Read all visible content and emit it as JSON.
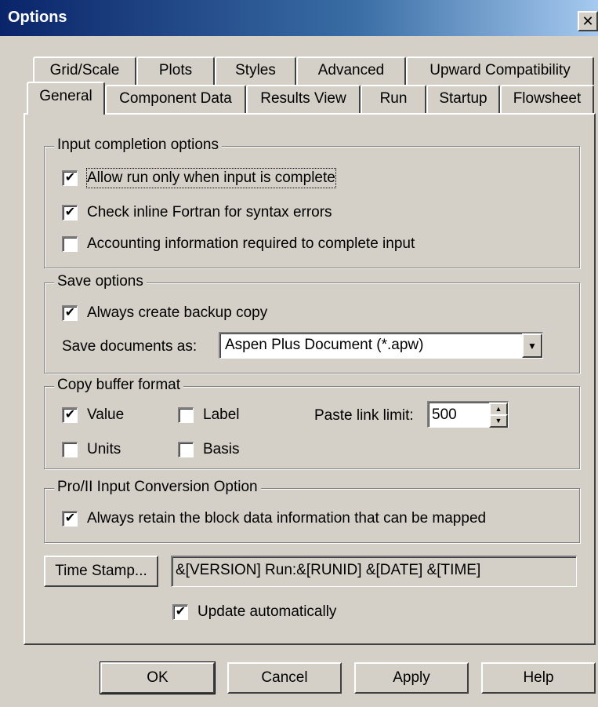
{
  "window": {
    "title": "Options",
    "close_label": "✕"
  },
  "tabs": {
    "row1": [
      "Grid/Scale",
      "Plots",
      "Styles",
      "Advanced",
      "Upward Compatibility"
    ],
    "row2": [
      "General",
      "Component Data",
      "Results View",
      "Run",
      "Startup",
      "Flowsheet"
    ],
    "active": "General"
  },
  "input_completion": {
    "legend": "Input completion options",
    "items": [
      {
        "label": "Allow run only when input is complete",
        "checked": true
      },
      {
        "label": "Check inline Fortran for syntax errors",
        "checked": true
      },
      {
        "label": "Accounting information required to complete input",
        "checked": false
      }
    ]
  },
  "save_options": {
    "legend": "Save options",
    "backup": {
      "label": "Always create backup copy",
      "checked": true
    },
    "save_as_label": "Save documents as:",
    "save_as_value": "Aspen Plus Document (*.apw)"
  },
  "copy_buffer": {
    "legend": "Copy buffer format",
    "value": {
      "label": "Value",
      "checked": true
    },
    "label": {
      "label": "Label",
      "checked": false
    },
    "units": {
      "label": "Units",
      "checked": false
    },
    "basis": {
      "label": "Basis",
      "checked": false
    },
    "paste_link_label": "Paste link limit:",
    "paste_link_value": "500"
  },
  "pro2": {
    "legend": "Pro/II Input Conversion Option",
    "retain": {
      "label": "Always retain the block data information that can be mapped",
      "checked": true
    }
  },
  "time_stamp": {
    "button_label": "Time Stamp...",
    "value": "&[VERSION] Run:&[RUNID] &[DATE] &[TIME]",
    "update": {
      "label": "Update automatically",
      "checked": true
    }
  },
  "buttons": {
    "ok": "OK",
    "cancel": "Cancel",
    "apply": "Apply",
    "help": "Help"
  },
  "colors": {
    "title_bar_start": "#0a246a",
    "title_bar_end": "#a6caf0",
    "face": "#d4d0c8"
  }
}
